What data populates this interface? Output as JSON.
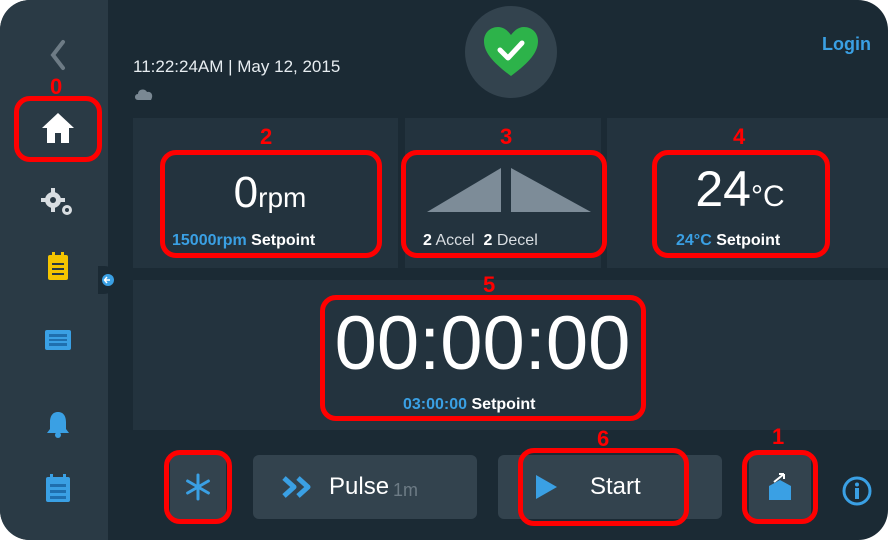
{
  "header": {
    "datetime": "11:22:24AM | May 12, 2015",
    "login_label": "Login"
  },
  "speed": {
    "value": "0",
    "unit": "rpm",
    "setpoint_value": "15000rpm",
    "setpoint_label": "Setpoint"
  },
  "accel": {
    "accel_value": "2",
    "accel_label": "Accel",
    "decel_value": "2",
    "decel_label": "Decel"
  },
  "temperature": {
    "value": "24",
    "unit": "°C",
    "setpoint_value": "24°C",
    "setpoint_label": "Setpoint"
  },
  "timer": {
    "value": "00:00:00",
    "setpoint_value": "03:00:00",
    "setpoint_label": "Setpoint"
  },
  "controls": {
    "pulse_label": "Pulse",
    "pulse_sub": "1m",
    "start_label": "Start"
  },
  "annotations": [
    "0",
    "1",
    "2",
    "3",
    "4",
    "5",
    "6"
  ],
  "sidebar": {
    "items": [
      "home-icon",
      "settings-icon",
      "program-icon",
      "display-icon",
      "alarm-icon",
      "log-icon"
    ]
  },
  "colors": {
    "background": "#1b2a34",
    "sidebar": "#2a3a45",
    "accent": "#3aa0e4",
    "heart": "#2db34a",
    "annotation": "#ff0000"
  }
}
